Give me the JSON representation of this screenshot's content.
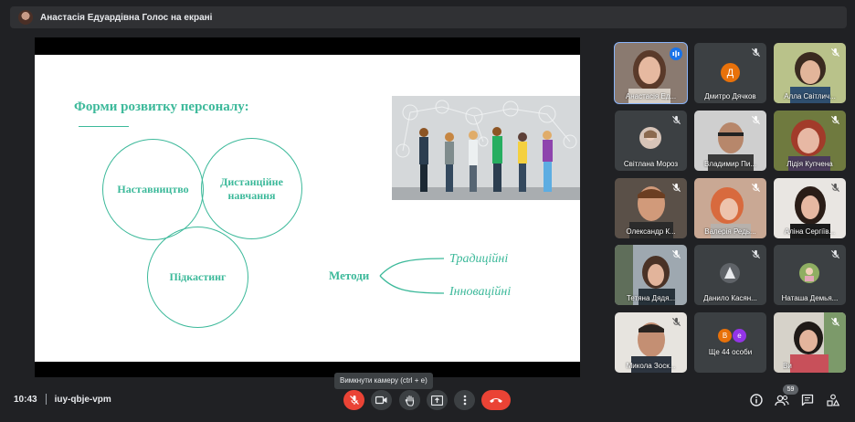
{
  "meeting": {
    "presenter_title": "Анастасія Едуардівна Голос на екрані",
    "time": "10:43",
    "code": "iuy-qbje-vpm",
    "tooltip": "Вимкнути камеру (ctrl + e)",
    "participants_badge": "59"
  },
  "slide": {
    "title": "Форми розвитку персоналу:",
    "circles": [
      "Наставництво",
      "Дистанційне навчання",
      "Підкастинг"
    ],
    "methods_label": "Методи",
    "methods": [
      "Традиційні",
      "Інноваційні"
    ]
  },
  "tiles": [
    {
      "name": "Анастасія Ед...",
      "kind": "video",
      "mic": "speaking"
    },
    {
      "name": "Дмитро Дячков",
      "kind": "letter",
      "letter": "Д",
      "color": "#e8710a",
      "mic": "muted"
    },
    {
      "name": "Алла Світлич...",
      "kind": "video",
      "mic": "muted"
    },
    {
      "name": "Світлана Мороз",
      "kind": "avatar",
      "mic": "muted"
    },
    {
      "name": "Владимир Пи...",
      "kind": "video",
      "mic": "muted"
    },
    {
      "name": "Лідія Купчена",
      "kind": "video",
      "mic": "muted"
    },
    {
      "name": "Олександр К...",
      "kind": "video",
      "mic": "muted"
    },
    {
      "name": "Валерія Редь...",
      "kind": "video",
      "mic": "muted"
    },
    {
      "name": "Аліна Сергіїв...",
      "kind": "video",
      "mic": "muted"
    },
    {
      "name": "Тетяна Дядя...",
      "kind": "video",
      "mic": "muted"
    },
    {
      "name": "Данило Касян...",
      "kind": "avatar",
      "mic": "muted"
    },
    {
      "name": "Наташа Демья...",
      "kind": "avatar",
      "mic": "muted"
    },
    {
      "name": "Микола Зоск...",
      "kind": "video",
      "mic": "muted"
    },
    {
      "name": "Ще 44 особи",
      "kind": "more",
      "letters": [
        "В",
        "е"
      ]
    },
    {
      "name": "Ви",
      "kind": "video",
      "mic": "muted"
    }
  ],
  "icons": {
    "mic": "mic-off-icon",
    "camera": "camera-icon",
    "hand": "raise-hand-icon",
    "present": "present-icon",
    "more": "more-vert-icon",
    "end": "end-call-icon",
    "info": "info-icon",
    "people": "people-icon",
    "chat": "chat-icon",
    "activities": "activities-icon"
  },
  "colors": {
    "accent": "#3cb99a",
    "danger": "#ea4335",
    "bg": "#202124",
    "tile": "#3c4043"
  }
}
